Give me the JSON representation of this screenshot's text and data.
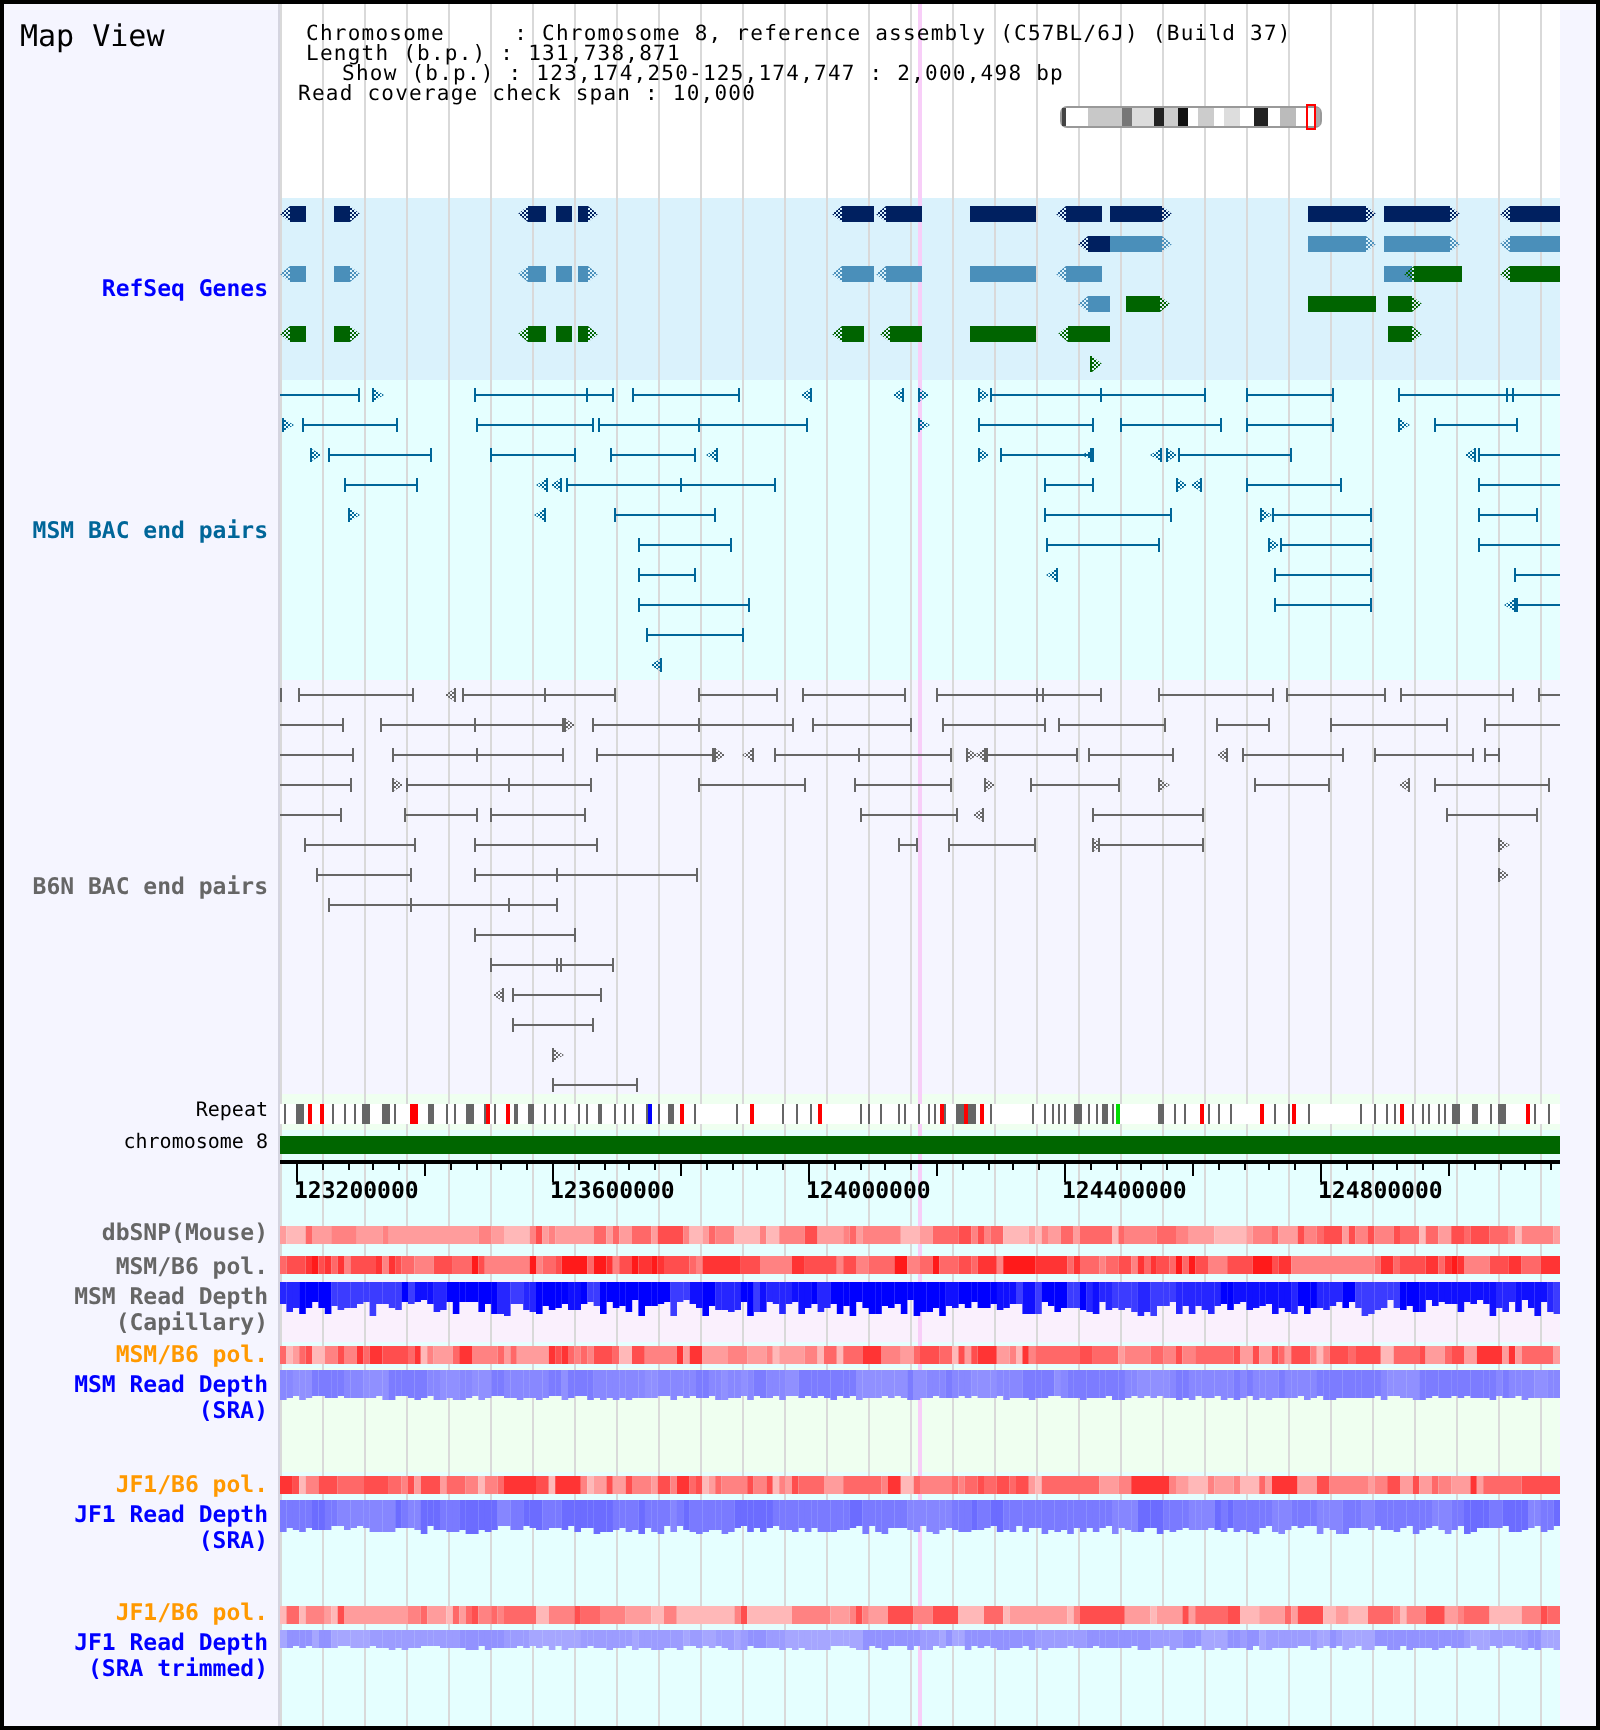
{
  "panel": {
    "title": "Map View"
  },
  "info_lines": [
    "Chromosome     : Chromosome 8, reference assembly (C57BL/6J) (Build 37)",
    "Length (b.p.) : 131,738,871",
    "Show (b.p.) : 123,174,250-125,174,747 : 2,000,498 bp",
    "Read coverage check span : 10,000"
  ],
  "tracks": [
    {
      "kind": "genes",
      "label": "RefSeq Genes",
      "color": "#0000ff"
    },
    {
      "kind": "pairs",
      "label": "MSM BAC end pairs",
      "color": "#006699"
    },
    {
      "kind": "pairs",
      "label": "B6N BAC end pairs",
      "color": "#666666"
    },
    {
      "kind": "repeat",
      "label": "Repeat"
    },
    {
      "kind": "chromosome",
      "label": "chromosome 8"
    },
    {
      "kind": "ruler",
      "tick_labels": [
        "123200000",
        "123600000",
        "124000000",
        "124400000",
        "124800000"
      ]
    },
    {
      "kind": "heat",
      "label": "dbSNP(Mouse)",
      "color": "#666666"
    },
    {
      "kind": "heat",
      "label": "MSM/B6 pol.",
      "color": "#666666"
    },
    {
      "kind": "depth",
      "label": "MSM Read Depth (Capillary)",
      "color": "#666666"
    },
    {
      "kind": "heat",
      "label": "MSM/B6 pol.",
      "color": "#ff9900"
    },
    {
      "kind": "depth",
      "label": "MSM Read Depth (SRA)",
      "color": "#0000ff"
    },
    {
      "kind": "heat",
      "label": "JF1/B6 pol.",
      "color": "#ff9900"
    },
    {
      "kind": "depth",
      "label": "JF1 Read Depth (SRA)",
      "color": "#0000ff"
    },
    {
      "kind": "heat",
      "label": "JF1/B6 pol.",
      "color": "#ff9900"
    },
    {
      "kind": "depth",
      "label": "JF1 Read Depth (SRA trimmed)",
      "color": "#0000ff"
    }
  ]
}
